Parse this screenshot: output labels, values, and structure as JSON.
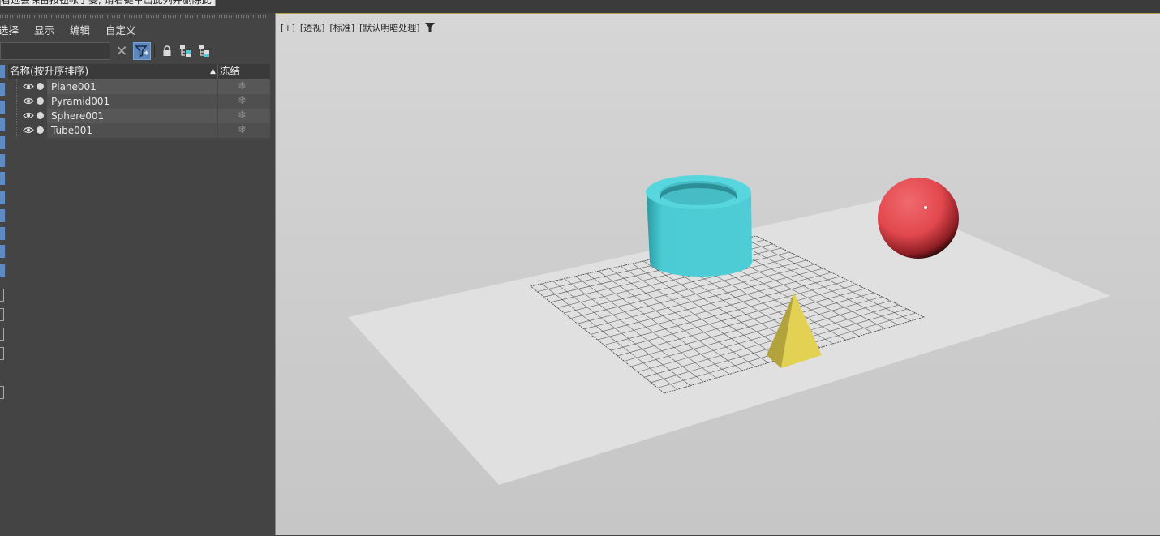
{
  "topbar": {
    "tooltip": "看选会保留按钮帐于要, 请右键单击此列并删除此"
  },
  "menu": [
    "选择",
    "显示",
    "编辑",
    "自定义"
  ],
  "toolbar": {
    "search_value": "",
    "clear_icon": "close-icon",
    "filter_icon": "funnel-plus-icon",
    "lock_icon": "lock-icon",
    "hierarchy_icons": [
      "tree-hierarchy-icon",
      "tree-layer-icon"
    ]
  },
  "explorer": {
    "column_name": "名称(按升序排序)",
    "column_frozen": "冻结",
    "rows": [
      {
        "name": "Plane001"
      },
      {
        "name": "Pyramid001"
      },
      {
        "name": "Sphere001"
      },
      {
        "name": "Tube001"
      }
    ]
  },
  "viewport": {
    "label_plus": "[+]",
    "label_view": "[透视]",
    "label_shading": "[标准]",
    "label_lighting": "[默认明暗处理]",
    "objects": [
      {
        "name": "Plane001",
        "color": "#e0e0e0"
      },
      {
        "name": "Pyramid001",
        "color": "#e2d152"
      },
      {
        "name": "Sphere001",
        "color": "#e8555a"
      },
      {
        "name": "Tube001",
        "color": "#4ccbd4"
      }
    ]
  },
  "colors": {
    "accent": "#5b87bf",
    "panel": "#444444",
    "viewport_border": "#b29f4c"
  }
}
